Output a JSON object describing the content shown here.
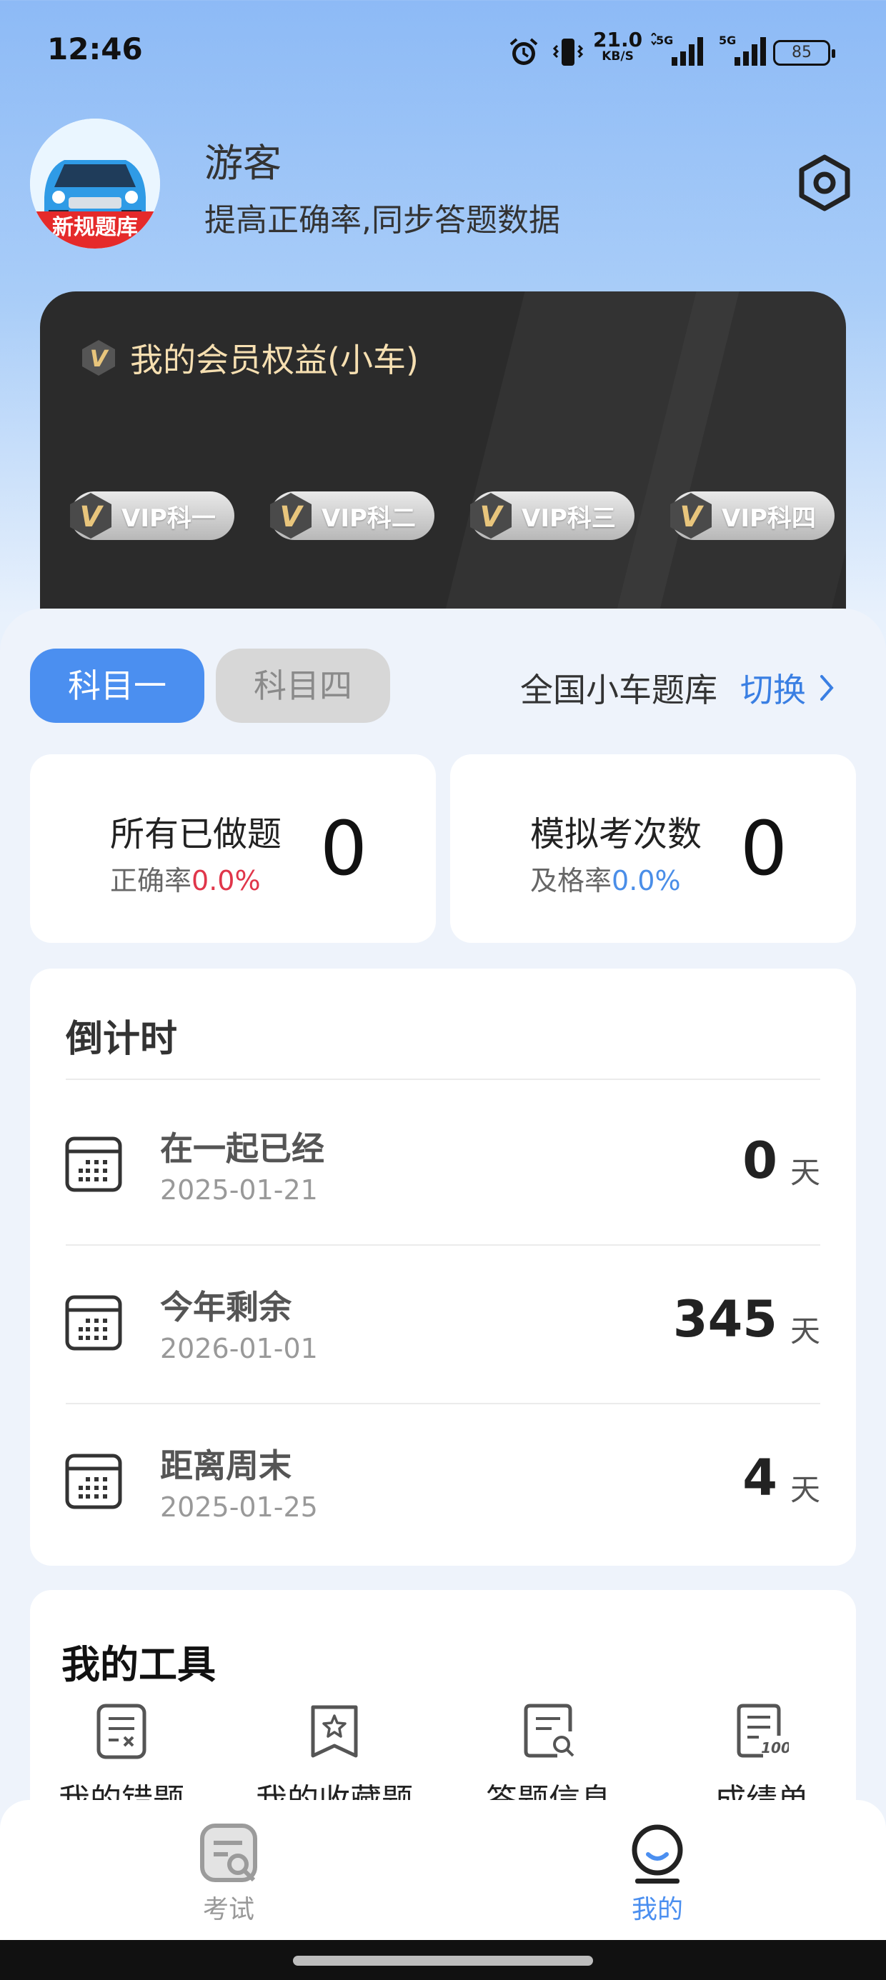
{
  "status_bar": {
    "time": "12:46",
    "net_speed": "21.0",
    "net_speed_unit": "KB/S",
    "signal_1": "5G",
    "signal_2": "5G",
    "battery": "85",
    "icons": [
      "alarm-icon",
      "vibrate-icon",
      "signal-icon",
      "signal-icon",
      "battery-icon"
    ]
  },
  "profile": {
    "avatar_text": "新规题库",
    "username": "游客",
    "subtitle": "提高正确率,同步答题数据"
  },
  "vip": {
    "title": "我的会员权益(小车)",
    "items": [
      "VIP科一",
      "VIP科二",
      "VIP科三",
      "VIP科四"
    ],
    "badge_letter": "V"
  },
  "tabs": {
    "items": [
      "科目一",
      "科目四"
    ],
    "active": "科目一"
  },
  "bank": {
    "name": "全国小车题库",
    "switch_label": "切换"
  },
  "stats": {
    "done": {
      "title": "所有已做题",
      "sub_label": "正确率",
      "sub_value": "0.0%",
      "value": "0"
    },
    "mock": {
      "title": "模拟考次数",
      "sub_label": "及格率",
      "sub_value": "0.0%",
      "value": "0"
    }
  },
  "countdown": {
    "title": "倒计时",
    "rows": [
      {
        "label": "在一起已经",
        "date": "2025-01-21",
        "value": "0",
        "unit": "天"
      },
      {
        "label": "今年剩余",
        "date": "2026-01-01",
        "value": "345",
        "unit": "天"
      },
      {
        "label": "距离周末",
        "date": "2025-01-25",
        "value": "4",
        "unit": "天"
      }
    ]
  },
  "tools": {
    "title": "我的工具",
    "items": [
      "我的错题",
      "我的收藏题",
      "答题信息",
      "成绩单"
    ]
  },
  "bottom_nav": {
    "items": [
      {
        "label": "考试",
        "icon": "exam-icon",
        "active": false
      },
      {
        "label": "我的",
        "icon": "profile-icon",
        "active": true
      }
    ]
  },
  "colors": {
    "accent": "#4b8ff0",
    "vip_gold": "#f6dfb1",
    "red": "#e0364a"
  }
}
